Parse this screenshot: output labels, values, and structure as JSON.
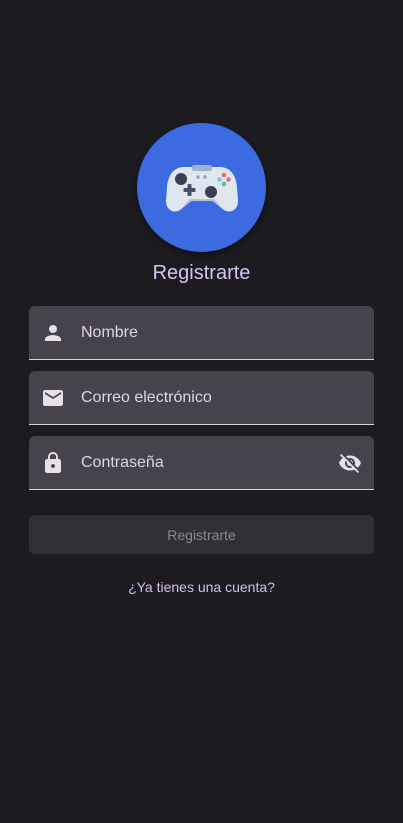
{
  "header": {
    "logo_icon": "gamepad-icon",
    "title": "Registrarte"
  },
  "form": {
    "name": {
      "placeholder": "Nombre",
      "icon": "person-icon"
    },
    "email": {
      "placeholder": "Correo electrónico",
      "icon": "mail-icon"
    },
    "password": {
      "placeholder": "Contraseña",
      "icon": "lock-icon",
      "toggle_icon": "visibility-off-icon"
    },
    "submit_label": "Registrarte",
    "login_link": "¿Ya tienes una cuenta?"
  },
  "colors": {
    "background": "#1c1b20",
    "accent": "#d9c2f5",
    "logo_circle": "#3c6ae0",
    "field_background": "#47434d",
    "button_disabled": "#323036"
  }
}
